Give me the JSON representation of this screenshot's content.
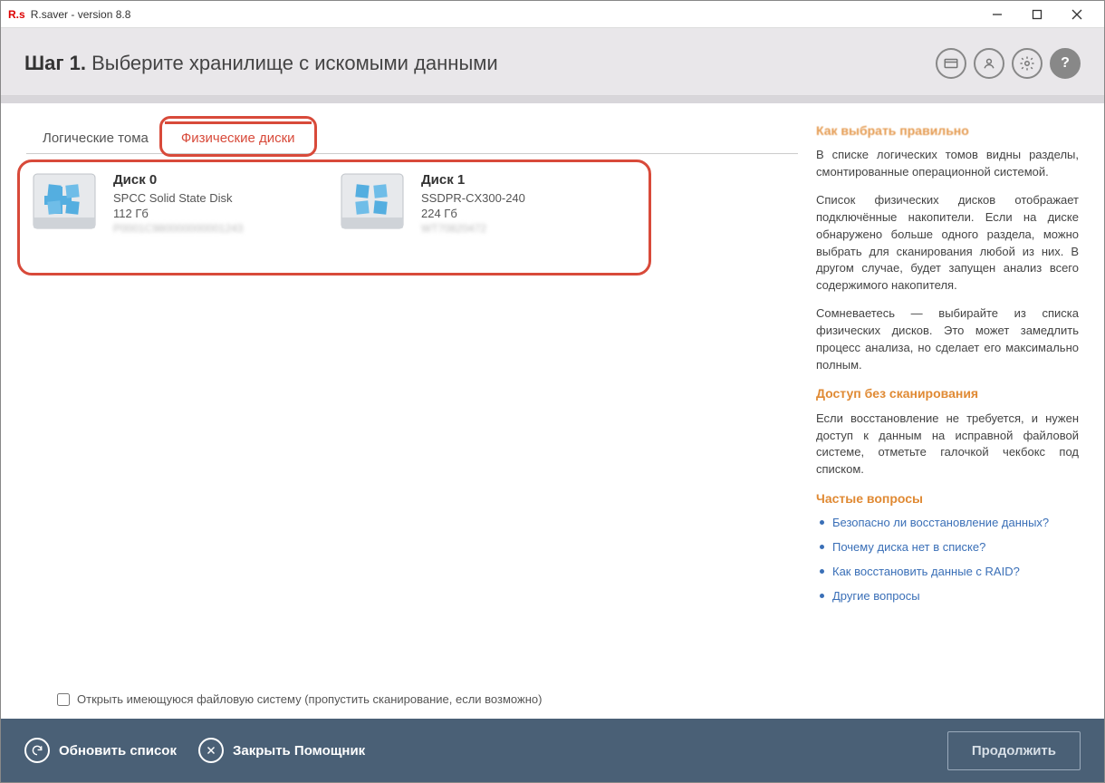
{
  "window": {
    "logo": "R.s",
    "title": "R.saver - version 8.8"
  },
  "step": {
    "prefix": "Шаг 1.",
    "title": "Выберите хранилище с искомыми данными"
  },
  "tabs": {
    "logical": "Логические тома",
    "physical": "Физические диски"
  },
  "disks": [
    {
      "title": "Диск 0",
      "model": "SPCC Solid State Disk",
      "size": "112 Гб",
      "serial": "P0001C980000000001243"
    },
    {
      "title": "Диск 1",
      "model": "SSDPR-CX300-240",
      "size": "224 Гб",
      "serial": "WT70820472"
    }
  ],
  "checkbox": {
    "label": "Открыть имеющуюся файловую систему (пропустить сканирование, если возможно)"
  },
  "help_panel": {
    "h1": "Как выбрать правильно",
    "p1": "В списке логических томов видны разделы, смонтированные операционной системой.",
    "p2": "Список физических дисков отображает подключённые накопители. Если на диске обнаружено больше одного раздела, можно выбрать для сканирования любой из них. В другом случае, будет запущен анализ всего содержимого накопителя.",
    "p3": "Сомневаетесь — выбирайте из списка физических дисков. Это может замедлить процесс анализа, но сделает его максимально полным.",
    "h2": "Доступ без сканирования",
    "p4": "Если восстановление не требуется, и нужен доступ к данным на исправной файловой системе, отметьте галочкой чекбокс под списком.",
    "h3": "Частые вопросы",
    "faq": [
      "Безопасно ли восстановление данных?",
      "Почему диска нет в списке?",
      "Как восстановить данные с RAID?",
      "Другие вопросы"
    ]
  },
  "footer": {
    "refresh": "Обновить список",
    "close": "Закрыть Помощник",
    "continue": "Продолжить"
  }
}
